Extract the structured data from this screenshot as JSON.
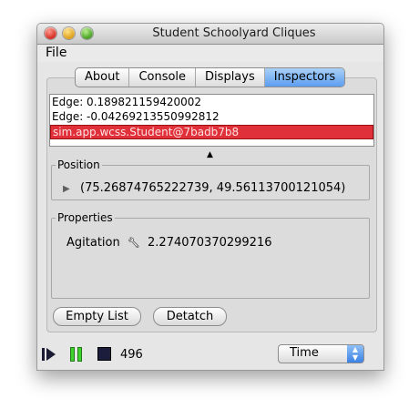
{
  "window": {
    "title": "Student Schoolyard Cliques"
  },
  "menu": {
    "file": "File"
  },
  "tabs": [
    {
      "label": "About",
      "active": false
    },
    {
      "label": "Console",
      "active": false
    },
    {
      "label": "Displays",
      "active": false
    },
    {
      "label": "Inspectors",
      "active": true
    }
  ],
  "inspector_list": {
    "items": [
      "Edge: 0.189821159420002",
      "Edge: -0.04269213550992812",
      "sim.app.wcss.Student@7badb7b8"
    ],
    "selected_index": 2
  },
  "position": {
    "legend": "Position",
    "value": "(75.26874765222739, 49.56113700121054)"
  },
  "properties": {
    "legend": "Properties",
    "name": "Agitation",
    "value": "2.274070370299216"
  },
  "buttons": {
    "empty_list": "Empty List",
    "detatch": "Detatch"
  },
  "controls": {
    "step_count": "496",
    "time_select": "Time"
  },
  "colors": {
    "selection": "#e0303a",
    "active_tab": "#5c9df0",
    "pause_button": "#3fd12e"
  }
}
